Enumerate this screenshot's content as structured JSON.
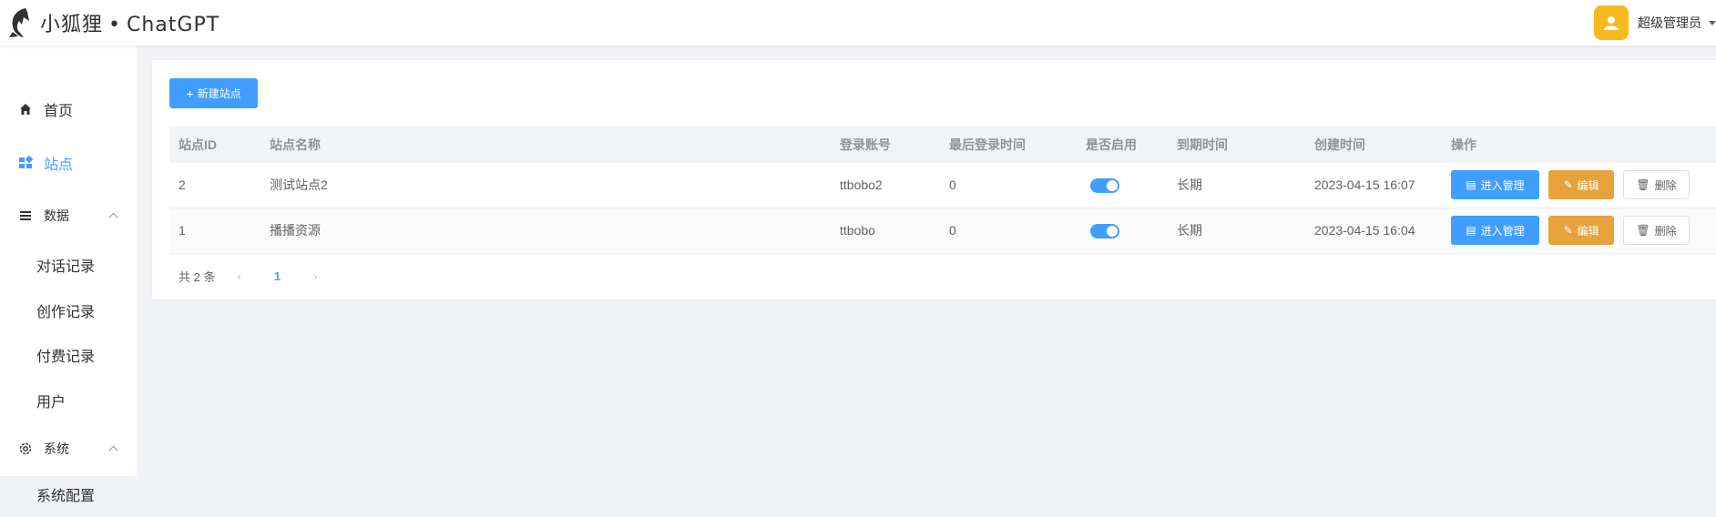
{
  "header": {
    "logo_text": "小狐狸",
    "logo_separator": "•",
    "logo_suffix": "ChatGPT",
    "user_name": "超级管理员"
  },
  "sidebar": {
    "items": [
      {
        "label": "首页",
        "icon": "home-icon"
      },
      {
        "label": "站点",
        "icon": "grid-icon"
      },
      {
        "label": "数据",
        "icon": "menu-icon"
      },
      {
        "label": "对话记录"
      },
      {
        "label": "创作记录"
      },
      {
        "label": "付费记录"
      },
      {
        "label": "用户"
      },
      {
        "label": "系统",
        "icon": "gear-icon"
      },
      {
        "label": "系统配置"
      }
    ]
  },
  "toolbar": {
    "new_site_label": "新建站点"
  },
  "table": {
    "columns": [
      "站点ID",
      "站点名称",
      "登录账号",
      "最后登录时间",
      "是否启用",
      "到期时间",
      "创建时间",
      "操作"
    ],
    "rows": [
      {
        "id": "2",
        "name": "测试站点2",
        "account": "ttbobo2",
        "last_login": "0",
        "enabled": true,
        "expire": "长期",
        "created": "2023-04-15 16:07"
      },
      {
        "id": "1",
        "name": "播播资源",
        "account": "ttbobo",
        "last_login": "0",
        "enabled": true,
        "expire": "长期",
        "created": "2023-04-15 16:04"
      }
    ],
    "actions": {
      "enter": "进入管理",
      "edit": "编辑",
      "delete": "删除"
    }
  },
  "pagination": {
    "total_text": "共 2 条",
    "current_page": "1"
  },
  "colors": {
    "primary": "#409eff",
    "warning": "#e6a23c",
    "avatar": "#f7ba1e"
  }
}
